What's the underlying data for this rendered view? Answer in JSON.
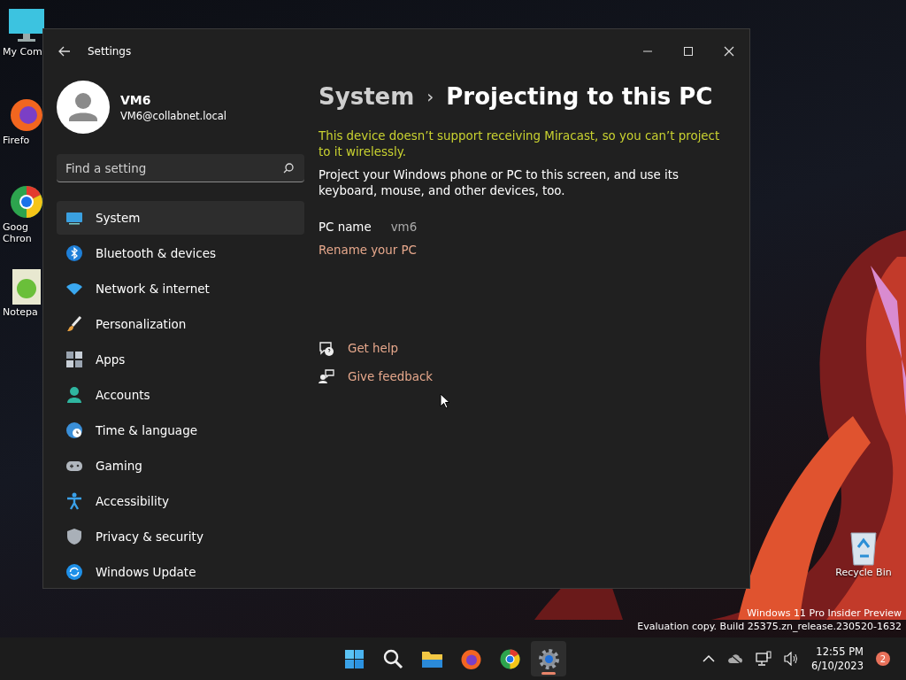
{
  "desktop": {
    "icons": [
      {
        "lines": [
          "My Com"
        ]
      },
      {
        "lines": [
          "Firefo"
        ]
      },
      {
        "lines": [
          "Goog",
          "Chron"
        ]
      },
      {
        "lines": [
          "Notepa"
        ]
      }
    ],
    "recycle_bin": {
      "label": "Recycle Bin"
    },
    "build_info": [
      "Windows 11 Pro Insider Preview",
      "Evaluation copy. Build 25375.zn_release.230520-1632"
    ]
  },
  "settings": {
    "title": "Settings",
    "user": {
      "name": "VM6",
      "email": "VM6@collabnet.local"
    },
    "search": {
      "placeholder": "Find a setting"
    },
    "nav": [
      {
        "label": "System",
        "selected": true
      },
      {
        "label": "Bluetooth & devices",
        "selected": false
      },
      {
        "label": "Network & internet",
        "selected": false
      },
      {
        "label": "Personalization",
        "selected": false
      },
      {
        "label": "Apps",
        "selected": false
      },
      {
        "label": "Accounts",
        "selected": false
      },
      {
        "label": "Time & language",
        "selected": false
      },
      {
        "label": "Gaming",
        "selected": false
      },
      {
        "label": "Accessibility",
        "selected": false
      },
      {
        "label": "Privacy & security",
        "selected": false
      },
      {
        "label": "Windows Update",
        "selected": false
      }
    ],
    "breadcrumb": {
      "parent": "System",
      "separator": "›",
      "current": "Projecting to this PC"
    },
    "warning": "This device doesn’t support receiving Miracast, so you can’t project to it wirelessly.",
    "description": "Project your Windows phone or PC to this screen, and use its keyboard, mouse, and other devices, too.",
    "pc_name": {
      "label": "PC name",
      "value": "vm6"
    },
    "rename_link": "Rename your PC",
    "help_links": [
      {
        "label": "Get help"
      },
      {
        "label": "Give feedback"
      }
    ]
  },
  "taskbar": {
    "apps": [
      {
        "selected": false
      },
      {
        "selected": false
      },
      {
        "selected": false
      },
      {
        "selected": false
      },
      {
        "selected": false
      },
      {
        "selected": true
      }
    ],
    "time": "12:55 PM",
    "date": "6/10/2023",
    "notification_count": "2"
  }
}
